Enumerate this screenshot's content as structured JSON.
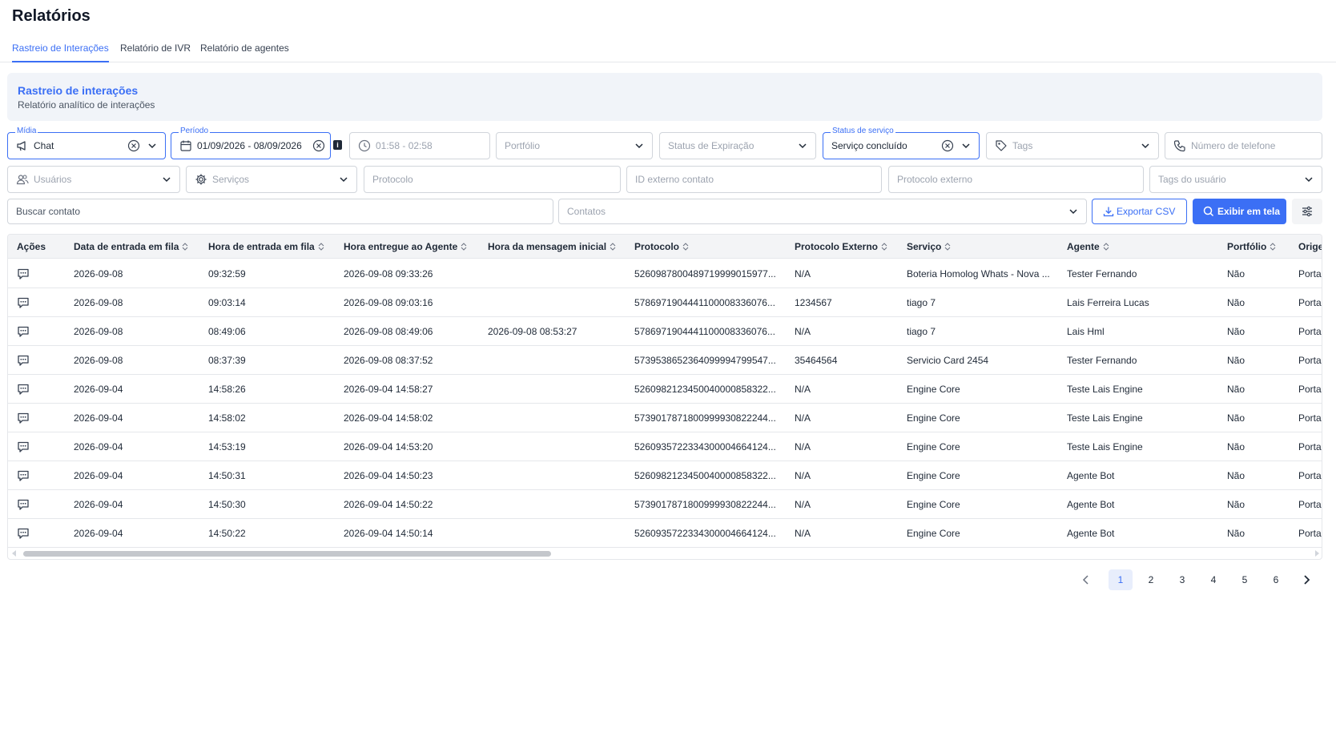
{
  "page": {
    "title": "Relatórios"
  },
  "tabs": [
    {
      "label": "Rastreio de Interações",
      "active": true
    },
    {
      "label": "Relatório de IVR",
      "active": false
    },
    {
      "label": "Relatório de agentes",
      "active": false
    }
  ],
  "banner": {
    "title": "Rastreio de interações",
    "subtitle": "Relatório analítico de interações"
  },
  "filters": {
    "midia": {
      "label": "Mídia",
      "value": "Chat",
      "icon": "megaphone-icon"
    },
    "periodo": {
      "label": "Período",
      "value": "01/09/2026 - 08/09/2026",
      "icon": "calendar-icon"
    },
    "hora": {
      "placeholder": "01:58 - 02:58",
      "icon": "clock-icon"
    },
    "portfolio": {
      "placeholder": "Portfólio"
    },
    "status_expiracao": {
      "placeholder": "Status de Expiração"
    },
    "status_servico": {
      "label": "Status de serviço",
      "value": "Serviço concluído"
    },
    "tags": {
      "placeholder": "Tags",
      "icon": "tag-icon"
    },
    "telefone": {
      "placeholder": "Número de telefone",
      "icon": "phone-icon"
    },
    "usuarios": {
      "placeholder": "Usuários",
      "icon": "users-icon"
    },
    "servicos": {
      "placeholder": "Serviços",
      "icon": "gear-icon"
    },
    "protocolo": {
      "placeholder": "Protocolo"
    },
    "id_externo": {
      "placeholder": "ID externo contato"
    },
    "protocolo_externo": {
      "placeholder": "Protocolo externo"
    },
    "tags_usuario": {
      "placeholder": "Tags do usuário"
    },
    "buscar_contato": {
      "placeholder": "Buscar contato"
    },
    "contatos": {
      "placeholder": "Contatos"
    }
  },
  "actions": {
    "export_label": "Exportar CSV",
    "show_label": "Exibir em tela"
  },
  "colors": {
    "accent": "#3b6ff5",
    "banner_bg": "#f1f4f9",
    "header_bg": "#f3f4f6"
  },
  "table": {
    "columns": [
      "Ações",
      "Data de entrada em fila",
      "Hora de entrada em fila",
      "Hora entregue ao Agente",
      "Hora da mensagem inicial",
      "Protocolo",
      "Protocolo Externo",
      "Serviço",
      "Agente",
      "Portfólio",
      "Origem"
    ],
    "rows": [
      [
        "",
        "2026-09-08",
        "09:32:59",
        "2026-09-08 09:33:26",
        "",
        "5260987800489719999015977...",
        "N/A",
        "Boteria Homolog Whats - Nova ...",
        "Tester Fernando",
        "Não",
        "Portal"
      ],
      [
        "",
        "2026-09-08",
        "09:03:14",
        "2026-09-08 09:03:16",
        "",
        "5786971904441100008336076...",
        "1234567",
        "tiago 7",
        "Lais Ferreira Lucas",
        "Não",
        "Portal"
      ],
      [
        "",
        "2026-09-08",
        "08:49:06",
        "2026-09-08 08:49:06",
        "2026-09-08 08:53:27",
        "5786971904441100008336076...",
        "N/A",
        "tiago 7",
        "Lais Hml",
        "Não",
        "Portal"
      ],
      [
        "",
        "2026-09-08",
        "08:37:39",
        "2026-09-08 08:37:52",
        "",
        "5739538652364099994799547...",
        "35464564",
        "Servicio Card 2454",
        "Tester Fernando",
        "Não",
        "Portal"
      ],
      [
        "",
        "2026-09-04",
        "14:58:26",
        "2026-09-04 14:58:27",
        "",
        "5260982123450040000858322...",
        "N/A",
        "Engine Core",
        "Teste Lais Engine",
        "Não",
        "Portal"
      ],
      [
        "",
        "2026-09-04",
        "14:58:02",
        "2026-09-04 14:58:02",
        "",
        "5739017871800999930822244...",
        "N/A",
        "Engine Core",
        "Teste Lais Engine",
        "Não",
        "Portal"
      ],
      [
        "",
        "2026-09-04",
        "14:53:19",
        "2026-09-04 14:53:20",
        "",
        "5260935722334300004664124...",
        "N/A",
        "Engine Core",
        "Teste Lais Engine",
        "Não",
        "Portal"
      ],
      [
        "",
        "2026-09-04",
        "14:50:31",
        "2026-09-04 14:50:23",
        "",
        "5260982123450040000858322...",
        "N/A",
        "Engine Core",
        "Agente Bot",
        "Não",
        "Portal"
      ],
      [
        "",
        "2026-09-04",
        "14:50:30",
        "2026-09-04 14:50:22",
        "",
        "5739017871800999930822244...",
        "N/A",
        "Engine Core",
        "Agente Bot",
        "Não",
        "Portal"
      ],
      [
        "",
        "2026-09-04",
        "14:50:22",
        "2026-09-04 14:50:14",
        "",
        "5260935722334300004664124...",
        "N/A",
        "Engine Core",
        "Agente Bot",
        "Não",
        "Portal"
      ]
    ]
  },
  "pagination": {
    "pages": [
      "1",
      "2",
      "3",
      "4",
      "5",
      "6"
    ],
    "current": "1"
  }
}
